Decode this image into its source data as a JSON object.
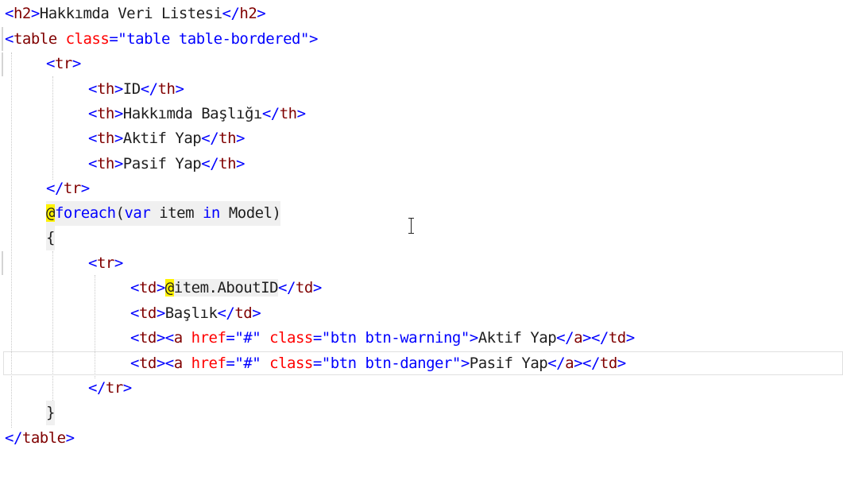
{
  "editor": {
    "lines": [
      {
        "text": "<h2>Hakkımda Veri Listesi</h2>"
      },
      {
        "text": "<table class=\"table table-bordered\">"
      },
      {
        "text": "<tr>"
      },
      {
        "text": "<th>ID</th>"
      },
      {
        "text": "<th>Hakkımda Başlığı</th>"
      },
      {
        "text": "<th>Aktif Yap</th>"
      },
      {
        "text": "<th>Pasif Yap</th>"
      },
      {
        "text": "</tr>"
      },
      {
        "text": "@foreach(var item in Model)"
      },
      {
        "text": "{"
      },
      {
        "text": "<tr>"
      },
      {
        "text": "<td>@item.AboutID</td>"
      },
      {
        "text": "<td>Başlık</td>"
      },
      {
        "text": "<td><a href=\"#\" class=\"btn btn-warning\">Aktif Yap</a></td>"
      },
      {
        "text": "<td><a href=\"#\" class=\"btn btn-danger\">Pasif Yap</a></td>"
      },
      {
        "text": "</tr>"
      },
      {
        "text": "}"
      },
      {
        "text": "</table>"
      }
    ],
    "tokens": {
      "h2": "h2",
      "h2_text": "Hakkımda Veri Listesi",
      "table": "table",
      "class_attr": "class",
      "table_class_value": "\"table table-bordered\"",
      "tr": "tr",
      "th": "th",
      "th_id": "ID",
      "th_title": "Hakkımda Başlığı",
      "th_active": "Aktif Yap",
      "th_passive": "Pasif Yap",
      "at": "@",
      "foreach": "foreach",
      "paren_open": "(",
      "var": "var",
      "item": "item",
      "in": "in",
      "model": "Model",
      "paren_close": ")",
      "brace_open": "{",
      "brace_close": "}",
      "td": "td",
      "item_about_id": "item.AboutID",
      "td_title": "Başlık",
      "a": "a",
      "href_attr": "href",
      "href_value": "\"#\"",
      "warning_class_value": "\"btn btn-warning\"",
      "danger_class_value": "\"btn btn-danger\"",
      "link_active": "Aktif Yap",
      "link_passive": "Pasif Yap"
    },
    "colors": {
      "tag": "#800000",
      "delimiter": "#0000ff",
      "attribute": "#ff0000",
      "attribute_value": "#0000ff",
      "keyword": "#0000ff",
      "razor_highlight": "#fff200"
    }
  }
}
